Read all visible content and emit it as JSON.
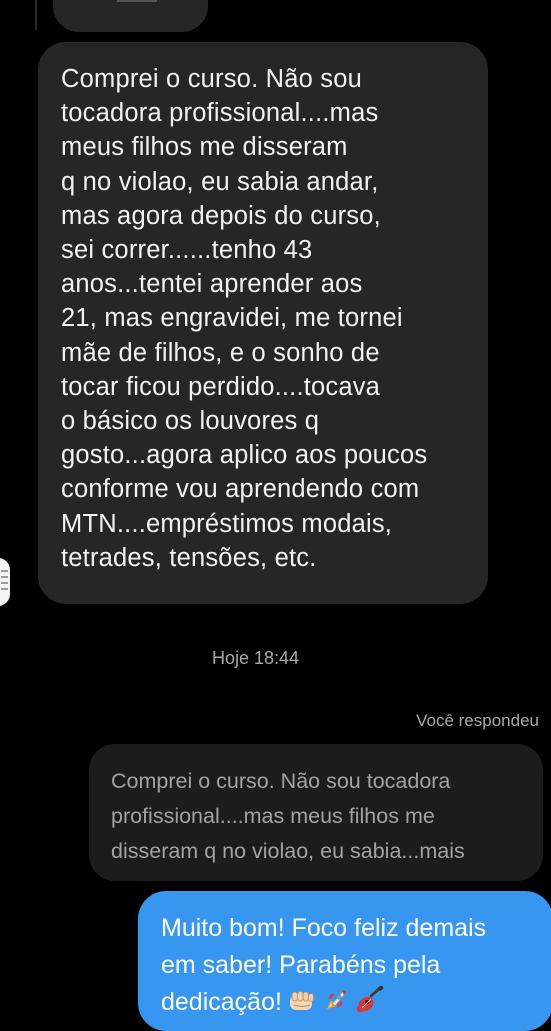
{
  "colors": {
    "background": "#000000",
    "incoming_bubble": "#262626",
    "quote_bubble": "#1c1c1c",
    "outgoing_bubble": "#3797f0",
    "meta_text": "#a8a8a8"
  },
  "incoming_message": {
    "lines": [
      "Comprei o curso. Não sou",
      "tocadora profissional....mas",
      "meus filhos me disseram",
      "q no violao, eu sabia andar,",
      "mas agora depois do curso,",
      "sei correr......tenho 43",
      "anos...tentei aprender aos",
      "21, mas engravidei, me tornei",
      "mãe de filhos, e o sonho de",
      "tocar ficou perdido....tocava",
      "o básico os louvores q",
      "gosto...agora aplico aos poucos",
      "conforme vou aprendendo com",
      "MTN....empréstimos modais,",
      "tetrades, tensões, etc."
    ]
  },
  "timestamp": "Hoje 18:44",
  "reply_label": "Você respondeu",
  "quoted_message": {
    "lines": [
      "Comprei o curso. Não sou tocadora",
      "profissional....mas meus filhos me",
      "disseram q no violao, eu sabia...mais"
    ]
  },
  "outgoing_message": {
    "lines": [
      "Muito bom! Foco feliz demais",
      "em saber! Parabéns pela",
      "dedicação!"
    ],
    "emoji_icons": [
      "fist-bump-icon",
      "rocket-icon",
      "guitar-icon"
    ]
  }
}
